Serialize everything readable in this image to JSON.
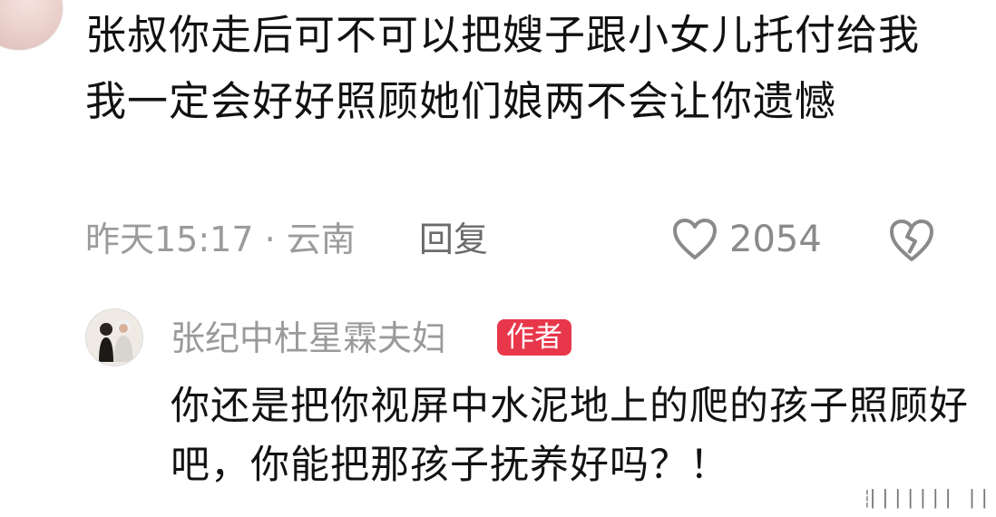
{
  "comment": {
    "text": "张叔你走后可不可以把嫂子跟小女儿托付给我我一定会好好照顾她们娘两不会让你遗憾",
    "time_location": "昨天15:17 · 云南",
    "reply_label": "回复",
    "likes": "2054"
  },
  "reply": {
    "author": "张纪中杜星霖夫妇",
    "badge": "作者",
    "text": "你还是把你视屏中水泥地上的爬的孩子照顾好吧，你能把那孩子抚养好吗？！"
  },
  "icons": {
    "like": "heart-outline-icon",
    "dislike": "broken-heart-icon"
  },
  "watermark": "┆▏▏▏▏▏▏▏▕▕"
}
